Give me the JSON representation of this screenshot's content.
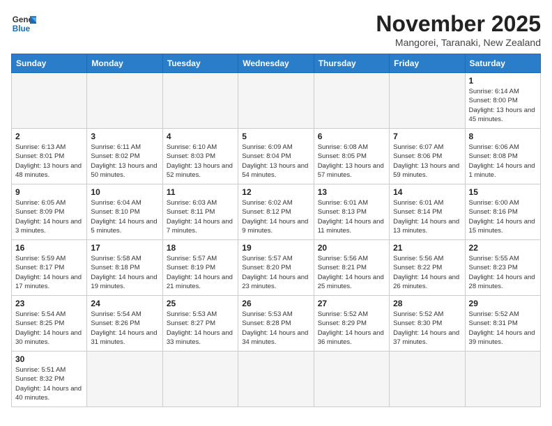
{
  "header": {
    "logo_general": "General",
    "logo_blue": "Blue",
    "month_title": "November 2025",
    "location": "Mangorei, Taranaki, New Zealand"
  },
  "days_of_week": [
    "Sunday",
    "Monday",
    "Tuesday",
    "Wednesday",
    "Thursday",
    "Friday",
    "Saturday"
  ],
  "weeks": [
    [
      {
        "day": "",
        "info": ""
      },
      {
        "day": "",
        "info": ""
      },
      {
        "day": "",
        "info": ""
      },
      {
        "day": "",
        "info": ""
      },
      {
        "day": "",
        "info": ""
      },
      {
        "day": "",
        "info": ""
      },
      {
        "day": "1",
        "info": "Sunrise: 6:14 AM\nSunset: 8:00 PM\nDaylight: 13 hours and 45 minutes."
      }
    ],
    [
      {
        "day": "2",
        "info": "Sunrise: 6:13 AM\nSunset: 8:01 PM\nDaylight: 13 hours and 48 minutes."
      },
      {
        "day": "3",
        "info": "Sunrise: 6:11 AM\nSunset: 8:02 PM\nDaylight: 13 hours and 50 minutes."
      },
      {
        "day": "4",
        "info": "Sunrise: 6:10 AM\nSunset: 8:03 PM\nDaylight: 13 hours and 52 minutes."
      },
      {
        "day": "5",
        "info": "Sunrise: 6:09 AM\nSunset: 8:04 PM\nDaylight: 13 hours and 54 minutes."
      },
      {
        "day": "6",
        "info": "Sunrise: 6:08 AM\nSunset: 8:05 PM\nDaylight: 13 hours and 57 minutes."
      },
      {
        "day": "7",
        "info": "Sunrise: 6:07 AM\nSunset: 8:06 PM\nDaylight: 13 hours and 59 minutes."
      },
      {
        "day": "8",
        "info": "Sunrise: 6:06 AM\nSunset: 8:08 PM\nDaylight: 14 hours and 1 minute."
      }
    ],
    [
      {
        "day": "9",
        "info": "Sunrise: 6:05 AM\nSunset: 8:09 PM\nDaylight: 14 hours and 3 minutes."
      },
      {
        "day": "10",
        "info": "Sunrise: 6:04 AM\nSunset: 8:10 PM\nDaylight: 14 hours and 5 minutes."
      },
      {
        "day": "11",
        "info": "Sunrise: 6:03 AM\nSunset: 8:11 PM\nDaylight: 14 hours and 7 minutes."
      },
      {
        "day": "12",
        "info": "Sunrise: 6:02 AM\nSunset: 8:12 PM\nDaylight: 14 hours and 9 minutes."
      },
      {
        "day": "13",
        "info": "Sunrise: 6:01 AM\nSunset: 8:13 PM\nDaylight: 14 hours and 11 minutes."
      },
      {
        "day": "14",
        "info": "Sunrise: 6:01 AM\nSunset: 8:14 PM\nDaylight: 14 hours and 13 minutes."
      },
      {
        "day": "15",
        "info": "Sunrise: 6:00 AM\nSunset: 8:16 PM\nDaylight: 14 hours and 15 minutes."
      }
    ],
    [
      {
        "day": "16",
        "info": "Sunrise: 5:59 AM\nSunset: 8:17 PM\nDaylight: 14 hours and 17 minutes."
      },
      {
        "day": "17",
        "info": "Sunrise: 5:58 AM\nSunset: 8:18 PM\nDaylight: 14 hours and 19 minutes."
      },
      {
        "day": "18",
        "info": "Sunrise: 5:57 AM\nSunset: 8:19 PM\nDaylight: 14 hours and 21 minutes."
      },
      {
        "day": "19",
        "info": "Sunrise: 5:57 AM\nSunset: 8:20 PM\nDaylight: 14 hours and 23 minutes."
      },
      {
        "day": "20",
        "info": "Sunrise: 5:56 AM\nSunset: 8:21 PM\nDaylight: 14 hours and 25 minutes."
      },
      {
        "day": "21",
        "info": "Sunrise: 5:56 AM\nSunset: 8:22 PM\nDaylight: 14 hours and 26 minutes."
      },
      {
        "day": "22",
        "info": "Sunrise: 5:55 AM\nSunset: 8:23 PM\nDaylight: 14 hours and 28 minutes."
      }
    ],
    [
      {
        "day": "23",
        "info": "Sunrise: 5:54 AM\nSunset: 8:25 PM\nDaylight: 14 hours and 30 minutes."
      },
      {
        "day": "24",
        "info": "Sunrise: 5:54 AM\nSunset: 8:26 PM\nDaylight: 14 hours and 31 minutes."
      },
      {
        "day": "25",
        "info": "Sunrise: 5:53 AM\nSunset: 8:27 PM\nDaylight: 14 hours and 33 minutes."
      },
      {
        "day": "26",
        "info": "Sunrise: 5:53 AM\nSunset: 8:28 PM\nDaylight: 14 hours and 34 minutes."
      },
      {
        "day": "27",
        "info": "Sunrise: 5:52 AM\nSunset: 8:29 PM\nDaylight: 14 hours and 36 minutes."
      },
      {
        "day": "28",
        "info": "Sunrise: 5:52 AM\nSunset: 8:30 PM\nDaylight: 14 hours and 37 minutes."
      },
      {
        "day": "29",
        "info": "Sunrise: 5:52 AM\nSunset: 8:31 PM\nDaylight: 14 hours and 39 minutes."
      }
    ],
    [
      {
        "day": "30",
        "info": "Sunrise: 5:51 AM\nSunset: 8:32 PM\nDaylight: 14 hours and 40 minutes."
      },
      {
        "day": "",
        "info": ""
      },
      {
        "day": "",
        "info": ""
      },
      {
        "day": "",
        "info": ""
      },
      {
        "day": "",
        "info": ""
      },
      {
        "day": "",
        "info": ""
      },
      {
        "day": "",
        "info": ""
      }
    ]
  ]
}
